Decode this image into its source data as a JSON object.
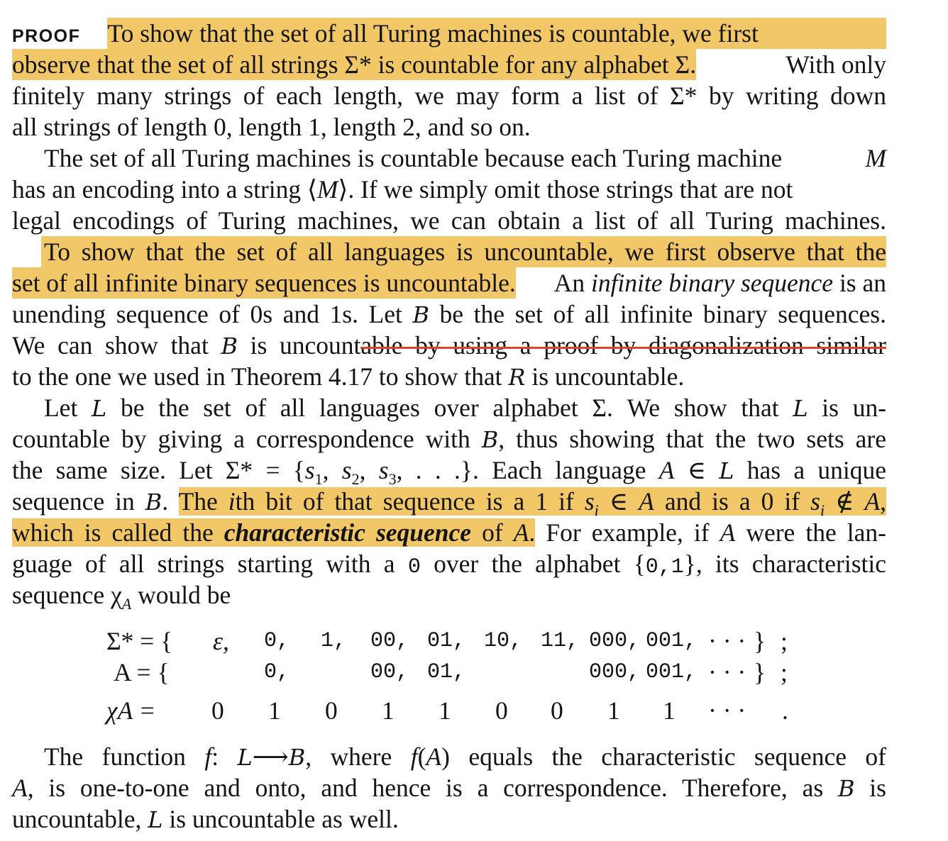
{
  "proof_label": "PROOF",
  "paragraph1": [
    [
      "To show that the set of all Turing machines is countable, we first"
    ],
    [
      "observe that the set of all strings Σ* is countable for any alphabet Σ.",
      " With only"
    ],
    [
      "finitely many strings of each length, we may form a list of Σ* by writing down"
    ],
    [
      "all strings of length 0, length 1, length 2, and so on."
    ]
  ],
  "paragraph2": [
    [
      "The set of all Turing machines is countable because each Turing machine ",
      "M"
    ],
    [
      "has an encoding into a string ⟨",
      "M",
      "⟩. If we simply omit those strings that are not"
    ],
    [
      "legal encodings of Turing machines, we can obtain a list of all Turing machines."
    ]
  ],
  "paragraph3": [
    [
      "To show that the set of all languages is uncountable, we first observe that the"
    ],
    [
      "set of all infinite binary sequences is uncountable.",
      " An ",
      "infinite binary sequence",
      " is an"
    ],
    [
      "unending sequence of 0s and 1s. Let ",
      "B",
      " be the set of all infinite binary sequences."
    ],
    [
      "We can show that ",
      "B",
      " is uncount",
      "able by using a proof by diagonalization similar"
    ],
    [
      "to the one we used in Theorem 4.17 to show that ",
      "R",
      " is uncountable."
    ]
  ],
  "paragraph4": [
    [
      "Let ",
      "L",
      " be the set of all languages over alphabet Σ. We show that ",
      "L",
      " is un-"
    ],
    [
      "countable by giving a correspondence with ",
      "B",
      ", thus showing that the two sets are"
    ],
    [
      "the same size. Let Σ* = {",
      "s",
      "1",
      ", ",
      "s",
      "2",
      ", ",
      "s",
      "3",
      ", . . .}. Each language ",
      "A",
      " ∈ ",
      "L",
      " has a unique"
    ],
    [
      "sequence in ",
      "B",
      ". ",
      "The ",
      "i",
      "th bit of that sequence is a 1 if ",
      "s",
      "i",
      " ∈ ",
      "A",
      " and is a 0 if ",
      "s",
      "i",
      " ∉ ",
      "A",
      ","
    ],
    [
      "which is called the ",
      "characteristic sequence",
      " of ",
      "A",
      ".",
      " For example, if ",
      "A",
      " were the lan-"
    ],
    [
      "guage of all strings starting with a ",
      "0",
      " over the alphabet {",
      "0,1",
      "}, its characteristic"
    ],
    [
      "sequence χ",
      "A",
      " would be"
    ]
  ],
  "sequence_table": {
    "row1_label": "Σ* = {",
    "row1_items": [
      "ε,",
      "0,",
      "1,",
      "00,",
      "01,",
      "10,",
      "11,",
      "000,",
      "001,",
      "· · ·",
      "}",
      ";"
    ],
    "row2_label": "A = {",
    "row2_items": [
      "0,",
      "00,",
      "01,",
      "000,",
      "001,",
      "· · ·",
      "}",
      ";"
    ],
    "row3_label": "χA =",
    "row3_items": [
      "0",
      "1",
      "0",
      "1",
      "1",
      "0",
      "0",
      "1",
      "1",
      "· · ·",
      "."
    ]
  },
  "paragraph5": [
    [
      "The function ",
      "f",
      ": ",
      "L",
      "⟶",
      "B",
      ", where ",
      "f",
      "(",
      "A",
      ") equals the characteristic sequence of"
    ],
    [
      "A",
      ", is one-to-one and onto, and hence is a correspondence. Therefore, as ",
      "B",
      " is"
    ],
    [
      "uncountable, ",
      "L",
      " is uncountable as well."
    ]
  ],
  "colors": {
    "highlight": "#f2c768",
    "strikethrough": "#d9452e",
    "text": "#141414"
  }
}
